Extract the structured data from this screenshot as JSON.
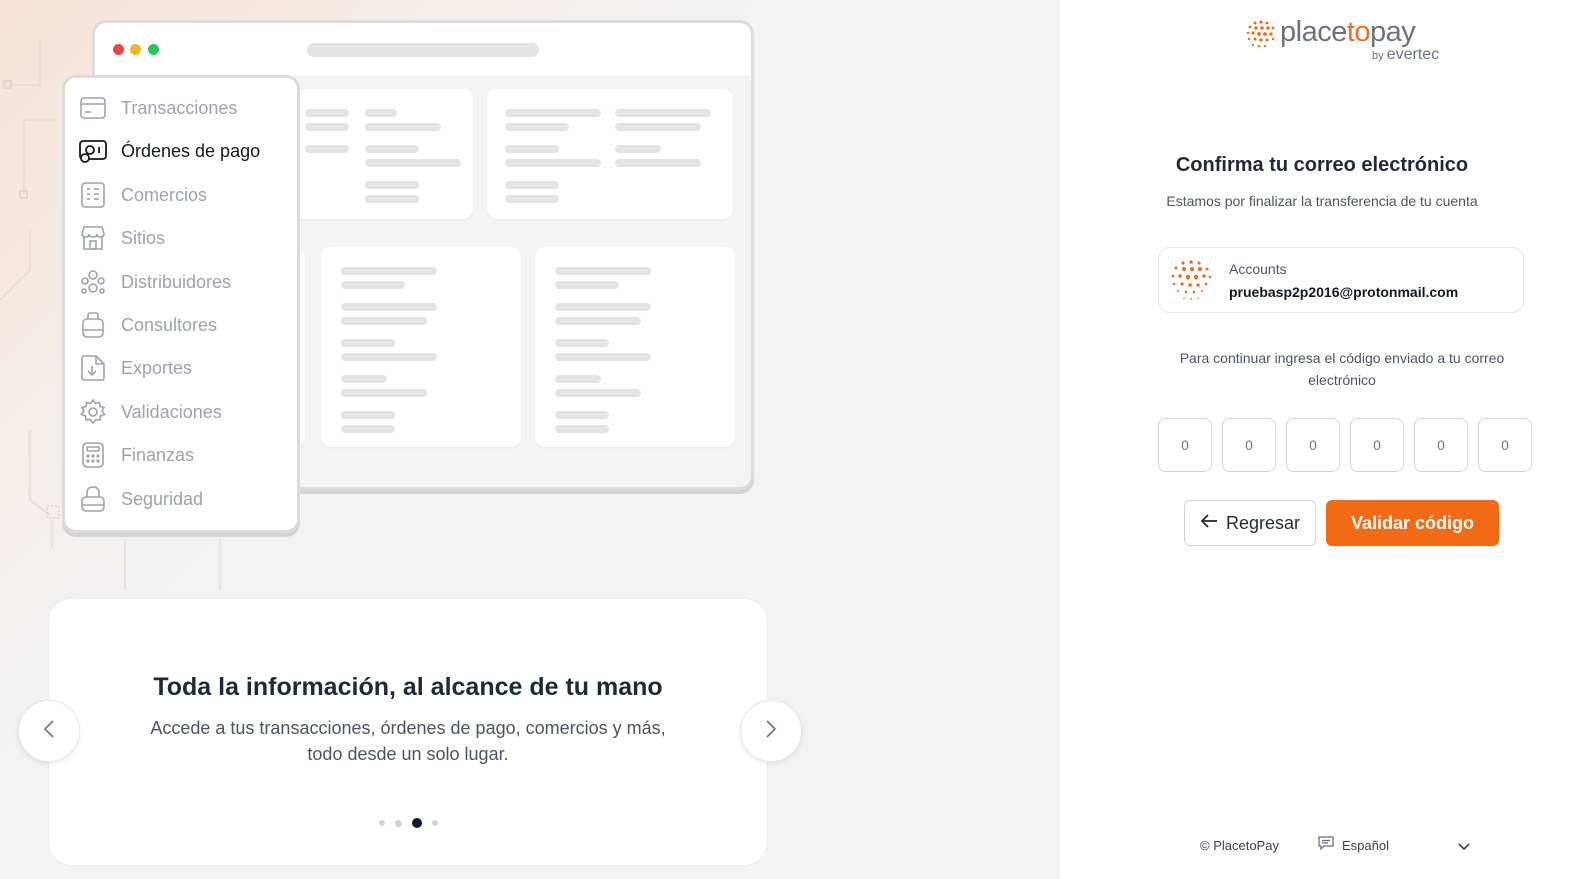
{
  "menu": {
    "items": [
      {
        "label": "Transacciones",
        "icon": "card-icon",
        "active": false
      },
      {
        "label": "Órdenes de pago",
        "icon": "payment-order-icon",
        "active": true
      },
      {
        "label": "Comercios",
        "icon": "building-icon",
        "active": false
      },
      {
        "label": "Sitios",
        "icon": "storefront-icon",
        "active": false
      },
      {
        "label": "Distribuidores",
        "icon": "users-group-icon",
        "active": false
      },
      {
        "label": "Consultores",
        "icon": "briefcase-icon",
        "active": false
      },
      {
        "label": "Exportes",
        "icon": "export-file-icon",
        "active": false
      },
      {
        "label": "Validaciones",
        "icon": "gear-icon",
        "active": false
      },
      {
        "label": "Finanzas",
        "icon": "calculator-icon",
        "active": false
      },
      {
        "label": "Seguridad",
        "icon": "lock-icon",
        "active": false
      }
    ]
  },
  "carousel": {
    "title": "Toda la información, al alcance de tu mano",
    "subtitle": "Accede a tus transacciones, órdenes de pago, comercios y más, todo desde un solo lugar.",
    "slide_count": 4,
    "active_index": 2
  },
  "brand": {
    "name_pre": "place",
    "name_mid": "to",
    "name_post": "pay",
    "by": "by",
    "parent": "evertec",
    "accent": "#f26a14"
  },
  "confirm": {
    "title": "Confirma tu correo electrónico",
    "subtitle": "Estamos por finalizar la transferencia de tu cuenta",
    "account_label": "Accounts",
    "account_email": "pruebasp2p2016@protonmail.com",
    "instruction": "Para continuar ingresa el código enviado a tu correo electrónico",
    "code_placeholder": "0",
    "back_label": "Regresar",
    "validate_label": "Validar código"
  },
  "footer": {
    "copyright": "© PlacetoPay",
    "language": "Español"
  }
}
